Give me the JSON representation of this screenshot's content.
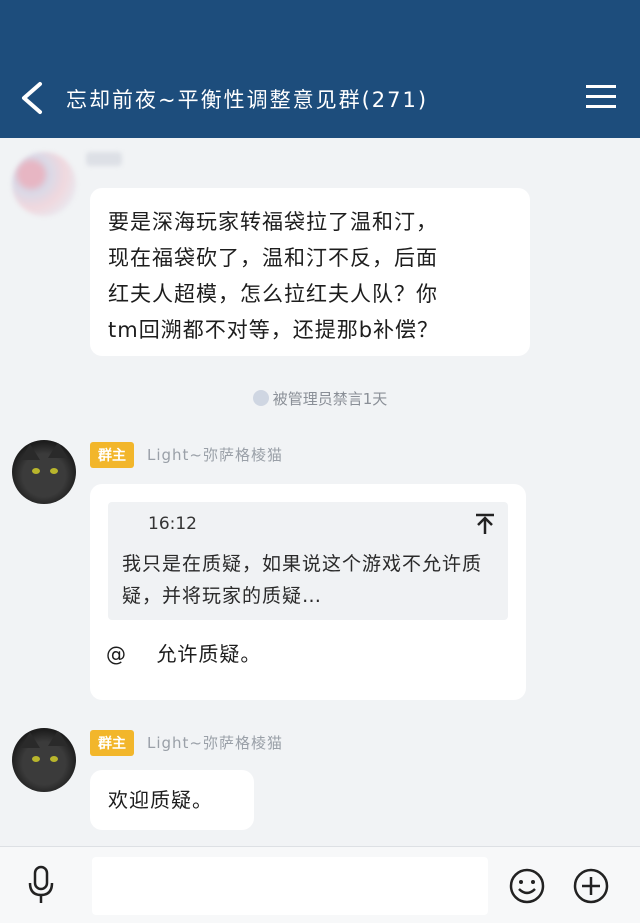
{
  "header": {
    "title": "忘却前夜~平衡性调整意见群(271)",
    "back_icon": "chevron-left-icon",
    "menu_icon": "hamburger-menu-icon",
    "background": "#1d4d7c"
  },
  "messages": [
    {
      "type": "text",
      "sender": "",
      "text_lines": [
        "要是深海玩家转福袋拉了温和汀，",
        "现在福袋砍了，温和汀不反，后面",
        "红夫人超模，怎么拉红夫人队？你",
        "tm回溯都不对等，还提那b补偿？"
      ]
    },
    {
      "type": "system",
      "text": "被管理员禁言1天"
    },
    {
      "type": "quote-reply",
      "badge": "群主",
      "sender": "Light~弥萨格棱猫",
      "quote_time": "16:12",
      "quote_text": "我只是在质疑，如果说这个游戏不允许质疑，并将玩家的质疑…",
      "reply_prefix": "@",
      "reply_text": "允许质疑。"
    },
    {
      "type": "text",
      "badge": "群主",
      "sender": "Light~弥萨格棱猫",
      "text": "欢迎质疑。"
    }
  ],
  "input_bar": {
    "placeholder": "",
    "mic_icon": "microphone-icon",
    "emoji_icon": "smiley-icon",
    "plus_icon": "plus-circle-icon"
  },
  "colors": {
    "badge": "#f2b62b",
    "bubble": "#ffffff",
    "chat_background": "#f1f3f5"
  }
}
